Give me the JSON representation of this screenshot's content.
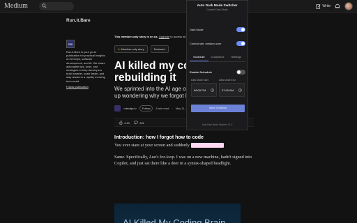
{
  "topbar": {
    "logo": "Medium",
    "write": "Write"
  },
  "publication": {
    "name": "Run.it.Bare",
    "logo_text": "RiB",
    "description": "Run.it.Bare is your go-to publication for practical insights on DevOps, software development, and AI. We share actionable tips, tools, and strategies to help developers build smarter, scale faster, and stay ahead in a rapidly evolving tech world.",
    "follow": "Follow publication"
  },
  "article": {
    "banner_bold": "This member-only story is on us.",
    "banner_link": "Upgrade",
    "banner_rest": " to access all of Medium.",
    "chips": [
      "Member-only story",
      "Featured"
    ],
    "title": "AI killed my coding b",
    "title_line2": "rebuilding it",
    "subtitle_line1": "We sprinted into the AI age of autocomp",
    "subtitle_line2": "up wondering why we forgot how to writ",
    "author": "<devdpu/>",
    "follow": "Follow",
    "read_time": "8 min read",
    "date": "May 11, 2025",
    "claps": "4.4K",
    "comments": "391",
    "section_heading": "Introduction: how I forgot how to code",
    "para1": "You ever stare at your screen and suddenly",
    "para2_a": "Same. Specifically, ",
    "para2_em": "Lua's",
    "para2_b": " for-loop. I was on a new machine, hadn't signed into Copilot, and just sat there like a deer in a syntax-shaped headlight.",
    "hero_text": "AI Killed My Coding Brain"
  },
  "popup": {
    "title": "Auto Dark Mode Switcher",
    "subtitle": "Control Dark Mode",
    "dark_mode_label": "Dark Mode",
    "dark_mode_on": true,
    "control_site_label": "Control site: medium.com",
    "control_site_on": true,
    "tabs": [
      "Schedule",
      "Customize",
      "Settings"
    ],
    "active_tab": "Schedule",
    "enable_schedule_label": "Enable Schedule",
    "enable_schedule_on": false,
    "start_label": "Dark Mode Start",
    "end_label": "Dark Mode End",
    "start_value": "08:00 PM",
    "end_value": "07:00 AM",
    "save_button": "Save Schedule",
    "footer": "Auto Dark Mode Switcher V1.0",
    "accent": "#6b8cff"
  }
}
